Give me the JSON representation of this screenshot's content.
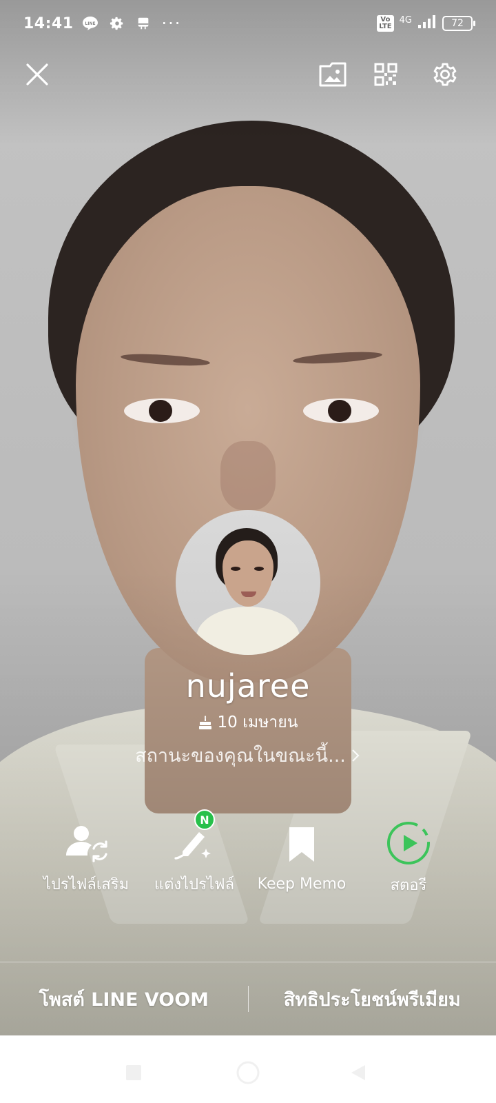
{
  "status_bar": {
    "time": "14:41",
    "more_dots": "···",
    "volte": "Vo\nLTE",
    "network": "4G",
    "battery": "72"
  },
  "top_bar": {
    "close_icon": "close-icon",
    "icons": [
      "gallery-icon",
      "qr-code-icon",
      "settings-gear-icon"
    ]
  },
  "profile": {
    "name": "nujaree",
    "birthday": "10 เมษายน",
    "status_message": "สถานะของคุณในขณะนี้..."
  },
  "actions": [
    {
      "label": "ไปรไฟล์เสริม",
      "icon": "sub-profile-icon"
    },
    {
      "label": "แต่งไปรไฟล์",
      "icon": "edit-profile-icon",
      "badge": "N"
    },
    {
      "label": "Keep Memo",
      "icon": "bookmark-icon"
    },
    {
      "label": "สตอรี",
      "icon": "story-play-icon"
    }
  ],
  "bottom_links": {
    "left": "โพสต์ LINE VOOM",
    "right": "สิทธิประโยชน์พรีเมียม"
  },
  "colors": {
    "accent_green": "#27c04b",
    "story_green": "#3cc45a"
  }
}
